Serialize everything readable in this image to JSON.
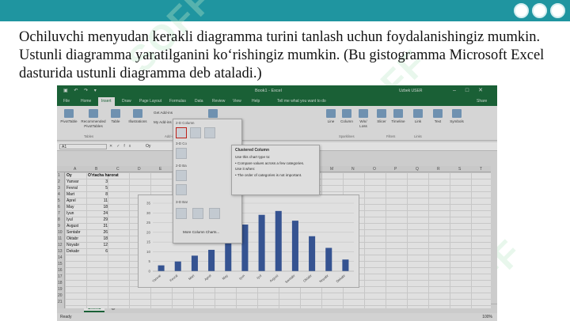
{
  "slide": {
    "text": "Ochiluvchi menyudan kerakli diagramma turini tanlash uchun foydalanishingiz mumkin. Ustunli diagramma yaratilganini koʻrishingiz mumkin. (Bu gistogramma Microsoft Excel dasturida ustunli diagramma deb ataladi.)",
    "watermark": "SOFF"
  },
  "excel": {
    "title": "Book1 - Excel",
    "user": "Uzbek USER",
    "tabs": [
      "File",
      "Home",
      "Insert",
      "Draw",
      "Page Layout",
      "Formulas",
      "Data",
      "Review",
      "View",
      "Help",
      "Tell me what you want to do",
      "Share"
    ],
    "active_tab": "Insert",
    "ribbon": {
      "pivot": "PivotTable",
      "recommended_pivot": "Recommended PivotTables",
      "table": "Table",
      "tables_group": "Tables",
      "illustrations": "Illustrations",
      "get_addins": "Get Add-ins",
      "my_addins": "My Add-ins",
      "addins_group": "Add-ins",
      "recommended_charts": "Recommended Charts",
      "line": "Line",
      "column": "Column",
      "winloss": "Win/ Loss",
      "sparklines_group": "Sparklines",
      "slicer": "Slicer",
      "timeline": "Timeline",
      "filters_group": "Filters",
      "link": "Link",
      "links_group": "Links",
      "text": "Text",
      "symbols": "Symbols"
    },
    "namebox": "A1",
    "formula": "Oy",
    "columns": [
      "A",
      "B",
      "C",
      "D",
      "E",
      "F",
      "G",
      "H",
      "I",
      "J",
      "K",
      "L",
      "M",
      "N",
      "O",
      "P",
      "Q",
      "R",
      "S",
      "T"
    ],
    "header_row": [
      "Oy",
      "O'rtacha harorat"
    ],
    "rows": [
      [
        "Yanvar",
        "3"
      ],
      [
        "Fevral",
        "5"
      ],
      [
        "Mart",
        "8"
      ],
      [
        "Aprel",
        "11"
      ],
      [
        "May",
        "18"
      ],
      [
        "Iyun",
        "24"
      ],
      [
        "Iyul",
        "29"
      ],
      [
        "Avgust",
        "31"
      ],
      [
        "Sentabr",
        "26"
      ],
      [
        "Oktabr",
        "18"
      ],
      [
        "Noyabr",
        "12"
      ],
      [
        "Dekabr",
        "6"
      ]
    ],
    "row_numbers": [
      "1",
      "2",
      "3",
      "4",
      "5",
      "6",
      "7",
      "8",
      "9",
      "10",
      "11",
      "12",
      "13",
      "14",
      "15",
      "16",
      "17",
      "18",
      "19",
      "20",
      "21"
    ],
    "sheet_tab": "Sheet1",
    "status_left": "Ready",
    "zoom": "100%"
  },
  "menu": {
    "section_2d": "2-D Column",
    "section_3d": "3-D Co",
    "section_2dbar": "2-D Ba",
    "section_3dbar": "3-D Bar",
    "more": "More Column Charts..."
  },
  "tooltip": {
    "title": "Clustered Column",
    "line1": "Use this chart type to:",
    "line2": "• Compare values across a few categories.",
    "line3": "Use it when:",
    "line4": "• The order of categories is not important."
  },
  "chart_data": {
    "type": "bar",
    "categories": [
      "Yanvar",
      "Fevral",
      "Mart",
      "Aprel",
      "May",
      "Iyun",
      "Iyul",
      "Avgust",
      "Sentabr",
      "Oktabr",
      "Noyabr",
      "Dekabr"
    ],
    "values": [
      3,
      5,
      8,
      11,
      18,
      24,
      29,
      31,
      26,
      18,
      12,
      6
    ],
    "yticks": [
      "0",
      "5",
      "10",
      "15",
      "20",
      "25",
      "30",
      "35"
    ],
    "ylim": [
      0,
      35
    ],
    "bar_color": "#3d5fa5",
    "title": "",
    "xlabel": "",
    "ylabel": ""
  },
  "colors": {
    "topbar": "#1f95a0",
    "excel_green": "#1e6e3e",
    "selection_red": "#d9251c"
  }
}
